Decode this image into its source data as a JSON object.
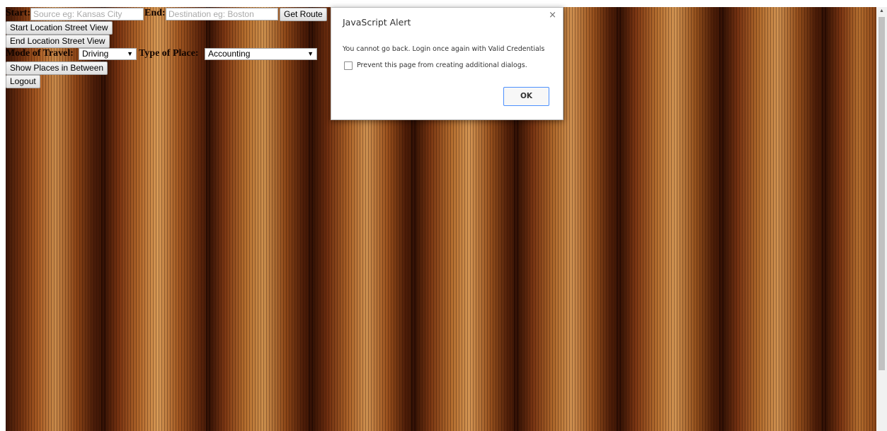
{
  "form": {
    "start_label": "Start:",
    "start_placeholder": "Source eg: Kansas City",
    "end_label": "End:",
    "end_placeholder": "Destination eg: Boston",
    "get_route_label": "Get Route",
    "start_street_view_label": "Start Location Street View",
    "end_street_view_label": "End Location Street View",
    "mode_label": "Mode of Travel:",
    "mode_value": "Driving",
    "place_type_label": "Type of Place:",
    "place_type_value": "Accounting",
    "show_places_label": "Show Places in Between",
    "logout_label": "Logout"
  },
  "dialog": {
    "title": "JavaScript Alert",
    "close_glyph": "×",
    "message": "You cannot go back. Login once again with Valid Credentials",
    "checkbox_label": "Prevent this page from creating additional dialogs.",
    "checkbox_checked": false,
    "ok_label": "OK"
  },
  "scrollbar": {
    "up_arrow_glyph": "▲"
  }
}
